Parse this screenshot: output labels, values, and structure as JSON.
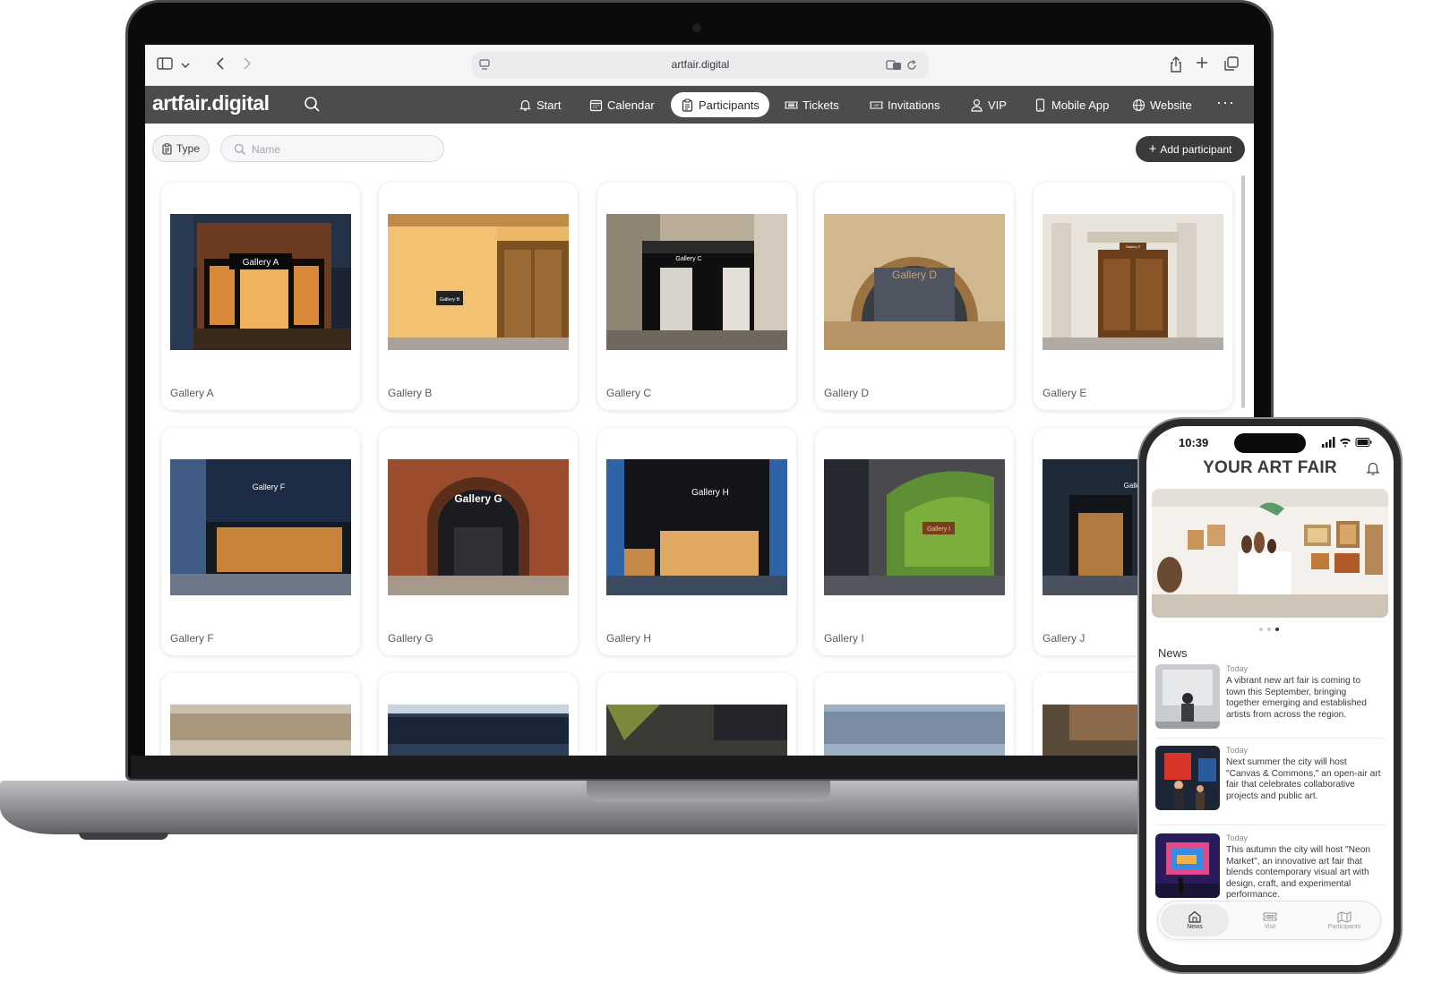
{
  "browser": {
    "url": "artfair.digital"
  },
  "app": {
    "logo": "artfair.digital",
    "nav": [
      {
        "label": "Start",
        "icon": "bell-icon",
        "active": false
      },
      {
        "label": "Calendar",
        "icon": "calendar-icon",
        "active": false
      },
      {
        "label": "Participants",
        "icon": "clipboard-icon",
        "active": true
      },
      {
        "label": "Tickets",
        "icon": "ticket-icon",
        "active": false
      },
      {
        "label": "Invitations",
        "icon": "vip-ticket-icon",
        "active": false
      },
      {
        "label": "VIP",
        "icon": "user-icon",
        "active": false
      },
      {
        "label": "Mobile App",
        "icon": "phone-icon",
        "active": false
      },
      {
        "label": "Website",
        "icon": "globe-icon",
        "active": false
      }
    ]
  },
  "toolbar": {
    "type_label": "Type",
    "name_placeholder": "Name",
    "add_label": "Add participant"
  },
  "participants": [
    {
      "name": "Gallery A",
      "sign": "Gallery A"
    },
    {
      "name": "Gallery B",
      "sign": "Gallery B"
    },
    {
      "name": "Gallery C",
      "sign": "Gallery C"
    },
    {
      "name": "Gallery D",
      "sign": "Gallery D"
    },
    {
      "name": "Gallery E",
      "sign": "Gallery E"
    },
    {
      "name": "Gallery F",
      "sign": "Gallery F"
    },
    {
      "name": "Gallery G",
      "sign": "Gallery G"
    },
    {
      "name": "Gallery H",
      "sign": "Gallery H"
    },
    {
      "name": "Gallery I",
      "sign": "Gallery I"
    },
    {
      "name": "Gallery J",
      "sign": "Galle"
    }
  ],
  "phone": {
    "time": "10:39",
    "title": "YOUR ART FAIR",
    "news_heading": "News",
    "news": [
      {
        "date": "Today",
        "text": "A vibrant new art fair is coming to town this September, bringing together emerging and established artists from across the region."
      },
      {
        "date": "Today",
        "text": "Next summer the city will host \"Canvas & Commons,\" an open-air art fair that celebrates collaborative projects and public art."
      },
      {
        "date": "Today",
        "text": "This autumn the city will host \"Neon Market\", an innovative art fair that blends contemporary visual art with design, craft, and experimental performance."
      }
    ],
    "tabs": [
      {
        "label": "News",
        "icon": "home-icon",
        "active": true
      },
      {
        "label": "Visit",
        "icon": "ticket-icon",
        "active": false
      },
      {
        "label": "Participants",
        "icon": "map-icon",
        "active": false
      }
    ]
  },
  "colors": {
    "nav_bg": "#4c4c4f",
    "add_button": "#3a3a3d",
    "active_tab": "#ffffff"
  }
}
